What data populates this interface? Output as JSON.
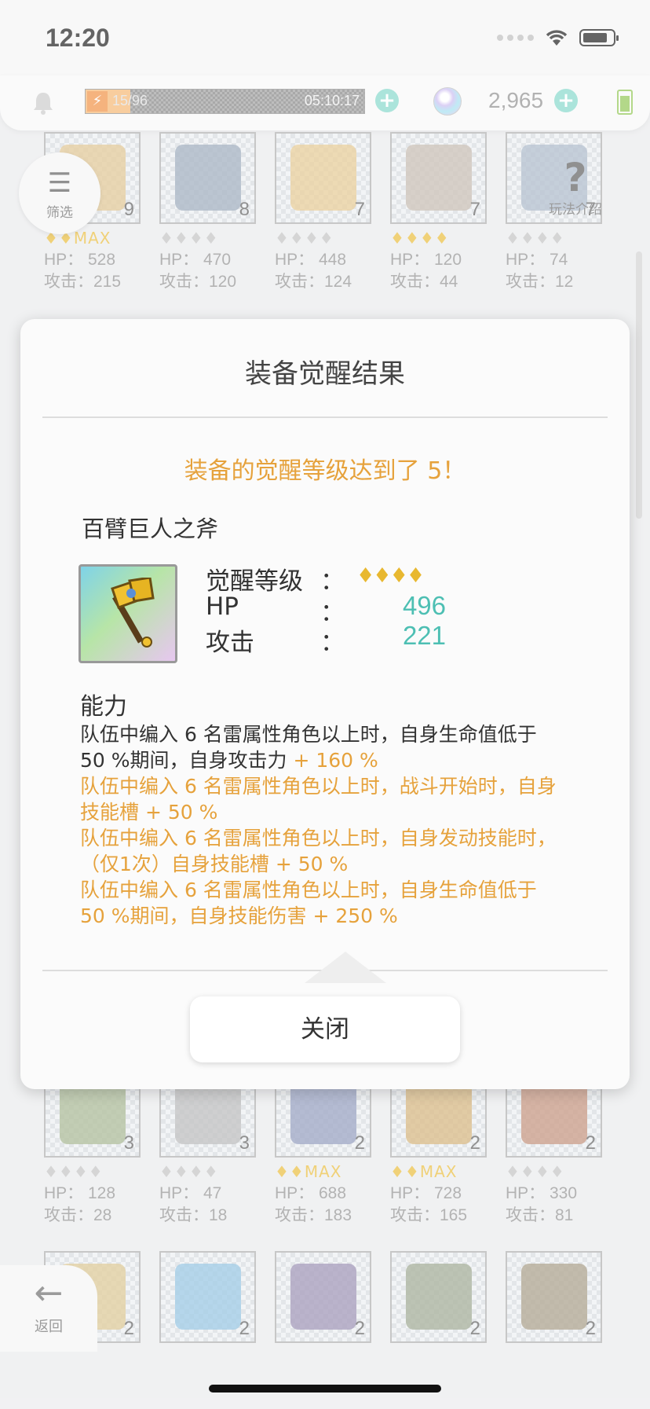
{
  "status_bar": {
    "time": "12:20"
  },
  "top_bar": {
    "stamina_text": "15/96",
    "stamina_timer": "05:10:17",
    "stamina_fraction": 0.16,
    "gem_count": "2,965"
  },
  "side_buttons": {
    "filter_label": "筛选",
    "help_label": "玩法介绍",
    "back_label": "返回"
  },
  "grid": {
    "row1": [
      {
        "count": "9",
        "stars": "♦♦MAX",
        "gold": true,
        "hp": "HP： 528",
        "atk": "攻击：215",
        "color": "#d9b36a"
      },
      {
        "count": "8",
        "stars": "♦♦♦♦",
        "gold": false,
        "hp": "HP： 470",
        "atk": "攻击：120",
        "color": "#7b8fa6"
      },
      {
        "count": "7",
        "stars": "♦♦♦♦",
        "gold": false,
        "hp": "HP： 448",
        "atk": "攻击：124",
        "color": "#e0b86b"
      },
      {
        "count": "7",
        "stars": "♦♦♦♦",
        "gold": true,
        "hp": "HP： 120",
        "atk": "攻击：44",
        "color": "#b4a495"
      },
      {
        "count": "7",
        "stars": "♦♦♦♦",
        "gold": false,
        "hp": "HP： 74",
        "atk": "攻击：12",
        "color": "#8fa2b8"
      }
    ],
    "row3": [
      {
        "count": "3",
        "stars": "♦♦♦♦",
        "gold": false,
        "hp": "HP： 128",
        "atk": "攻击：28",
        "color": "#8a9f6b"
      },
      {
        "count": "3",
        "stars": "♦♦♦♦",
        "gold": false,
        "hp": "HP： 47",
        "atk": "攻击：18",
        "color": "#a3a3a3"
      },
      {
        "count": "2",
        "stars": "♦♦MAX",
        "gold": true,
        "hp": "HP： 688",
        "atk": "攻击：183",
        "color": "#6e79a8"
      },
      {
        "count": "2",
        "stars": "♦♦MAX",
        "gold": true,
        "hp": "HP： 728",
        "atk": "攻击：165",
        "color": "#c99a4a"
      },
      {
        "count": "2",
        "stars": "♦♦♦♦",
        "gold": false,
        "hp": "HP： 330",
        "atk": "攻击：81",
        "color": "#b06a4a"
      }
    ],
    "row4": [
      {
        "count": "2",
        "color": "#d3b56a"
      },
      {
        "count": "2",
        "color": "#6fb1d9"
      },
      {
        "count": "2",
        "color": "#7a6a9a"
      },
      {
        "count": "2",
        "color": "#7e8a6a"
      },
      {
        "count": "2",
        "color": "#8a7a5a"
      }
    ]
  },
  "dialog": {
    "title": "装备觉醒结果",
    "message": "装备的觉醒等级达到了 5！",
    "item_name": "百臂巨人之斧",
    "awaken_label": "觉醒等级",
    "awaken_stars": "♦♦♦♦",
    "hp_label": "HP",
    "hp_value": "496",
    "atk_label": "攻击",
    "atk_value": "221",
    "colon": "：",
    "ability_title": "能力",
    "abilities": [
      {
        "text": "队伍中编入 6 名雷属性角色以上时，自身生命值低于",
        "style": "plain"
      },
      {
        "text": "50 %期间，自身攻击力 ",
        "style": "plain",
        "highlight": "+ 160 %"
      },
      {
        "text": "队伍中编入 6 名雷属性角色以上时，战斗开始时，自身",
        "style": "orange"
      },
      {
        "text": "技能槽 + 50 %",
        "style": "orange"
      },
      {
        "text": "队伍中编入 6 名雷属性角色以上时，自身发动技能时，",
        "style": "orange"
      },
      {
        "text": "（仅1次）自身技能槽 + 50 %",
        "style": "orange"
      },
      {
        "text": "队伍中编入 6 名雷属性角色以上时，自身生命值低于",
        "style": "orange"
      },
      {
        "text": "50 %期间，自身技能伤害 + 250 %",
        "style": "orange"
      }
    ],
    "close_label": "关闭"
  }
}
